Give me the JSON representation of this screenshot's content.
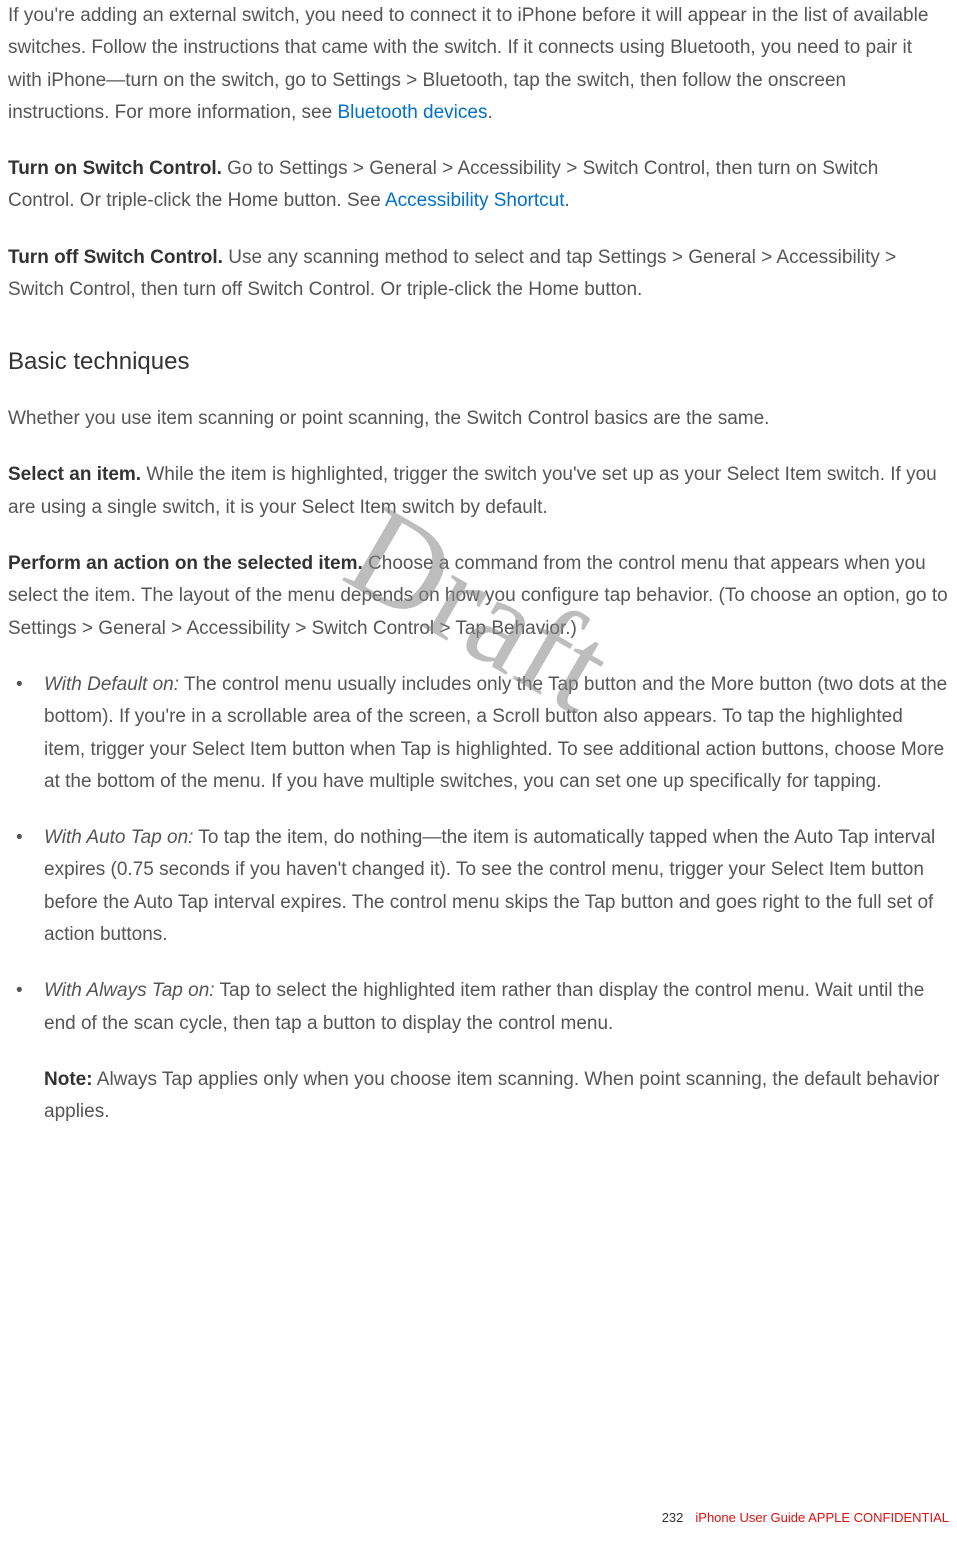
{
  "watermark": "Draft",
  "paragraphs": {
    "p1_pre": "If you're adding an external switch, you need to connect it to iPhone before it will appear in the list of available switches. Follow the instructions that came with the switch. If it connects using Bluetooth, you need to pair it with iPhone—turn on the switch, go to Settings > Bluetooth, tap the switch, then follow the onscreen instructions. For more information, see ",
    "p1_link": "Bluetooth devices",
    "p1_post": ".",
    "p2_bold": "Turn on Switch Control.",
    "p2_pre": " Go to Settings > General > Accessibility > Switch Control, then turn on Switch Control. Or triple-click the Home button. See ",
    "p2_link": "Accessibility Shortcut",
    "p2_post": ".",
    "p3_bold": "Turn off Switch Control.",
    "p3_body": " Use any scanning method to select and tap Settings > General > Accessibility > Switch Control, then turn off Switch Control. Or triple-click the Home button.",
    "h2": "Basic techniques",
    "p4": "Whether you use item scanning or point scanning, the Switch Control basics are the same.",
    "p5_bold": "Select an item.",
    "p5_body": " While the item is highlighted, trigger the switch you've set up as your Select Item switch. If you are using a single switch, it is your Select Item switch by default.",
    "p6_bold": "Perform an action on the selected item.",
    "p6_body": " Choose a command from the control menu that appears when you select the item. The layout of the menu depends on how you configure tap behavior. (To choose an option, go to Settings > General > Accessibility > Switch Control > Tap Behavior.)",
    "li1_em": "With Default on:",
    "li1_body": " The control menu usually includes only the Tap button and the More button (two dots at the bottom). If you're in a scrollable area of the screen, a Scroll button also appears. To tap the highlighted item, trigger your Select Item button when Tap is highlighted. To see additional action buttons, choose More at the bottom of the menu. If you have multiple switches, you can set one up specifically for tapping.",
    "li2_em": "With Auto Tap on:",
    "li2_body": " To tap the item, do nothing—the item is automatically tapped when the Auto Tap interval expires (0.75 seconds if you haven't changed it). To see the control menu, trigger your Select Item button before the Auto Tap interval expires. The control menu skips the Tap button and goes right to the full set of action buttons.",
    "li3_em": "With Always Tap on:",
    "li3_body": " Tap to select the highlighted item rather than display the control menu. Wait until the end of the scan cycle, then tap a button to display the control menu.",
    "note_bold": "Note:",
    "note_body": " Always Tap applies only when you choose item scanning. When point scanning, the default behavior applies."
  },
  "footer": {
    "page": "232",
    "text": "iPhone User Guide  APPLE CONFIDENTIAL"
  }
}
